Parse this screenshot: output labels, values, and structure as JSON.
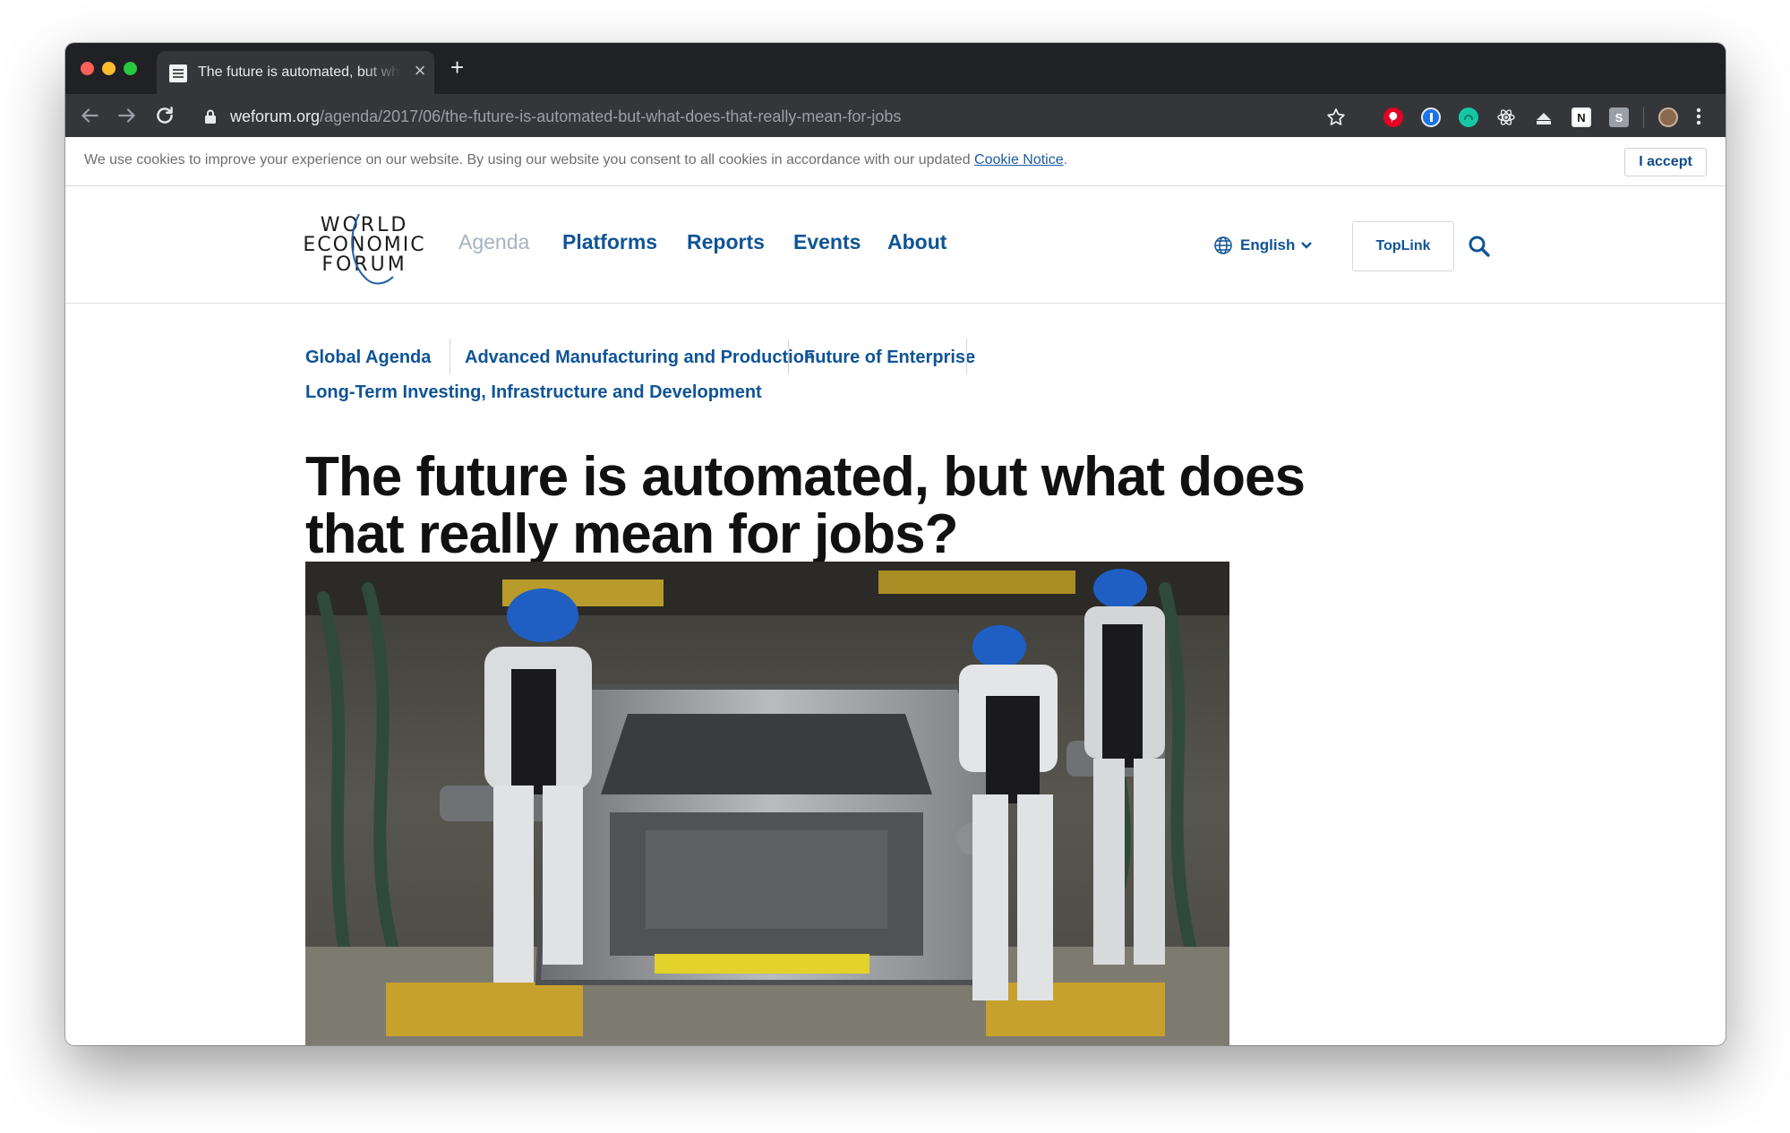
{
  "browser": {
    "tab_title": "The future is automated, but what does that really mean for jobs?",
    "tab_close": "×",
    "new_tab": "+",
    "url_host": "weforum.org",
    "url_path": "/agenda/2017/06/the-future-is-automated-but-what-does-that-really-mean-for-jobs",
    "extensions": [
      "pinterest-icon",
      "onepassword-icon",
      "mailtrack-icon",
      "react-devtools-icon",
      "stash-icon",
      "notion-icon",
      "s-extension-icon",
      "profile-avatar"
    ],
    "notion_glyph": "N",
    "s_glyph": "S"
  },
  "cookie_bar": {
    "text": "We use cookies to improve your experience on our website. By using our website you consent to all cookies in accordance with our updated ",
    "link": "Cookie Notice",
    "trailing": ".",
    "accept_label": "I accept"
  },
  "header": {
    "logo_lines": [
      "WORLD",
      "ECONOMIC",
      "FORUM"
    ],
    "nav": [
      "Agenda",
      "Platforms",
      "Reports",
      "Events",
      "About"
    ],
    "language": "English",
    "toplink": "TopLink"
  },
  "article": {
    "topics": [
      "Global Agenda",
      "Advanced Manufacturing and Production",
      "Future of Enterprise",
      "Long-Term Investing, Infrastructure and Development"
    ],
    "title_line1": "The future is automated, but what does",
    "title_line2": "that really mean for jobs?"
  },
  "colors": {
    "brand_blue": "#0f5496",
    "nav_muted": "#a7b2bf",
    "chrome_dark": "#202124",
    "chrome_toolbar": "#35363a"
  }
}
